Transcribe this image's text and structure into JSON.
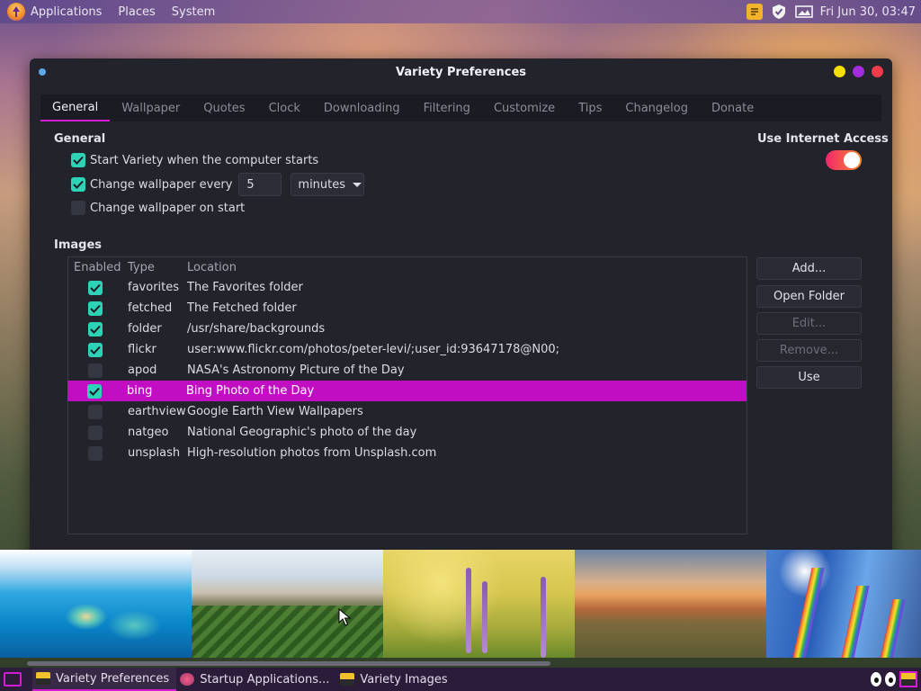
{
  "top_panel": {
    "menus": [
      "Applications",
      "Places",
      "System"
    ],
    "clock": "Fri Jun 30, 03:47"
  },
  "window": {
    "title": "Variety Preferences",
    "tabs": [
      {
        "label": "General",
        "active": true
      },
      {
        "label": "Wallpaper"
      },
      {
        "label": "Quotes"
      },
      {
        "label": "Clock"
      },
      {
        "label": "Downloading"
      },
      {
        "label": "Filtering"
      },
      {
        "label": "Customize"
      },
      {
        "label": "Tips"
      },
      {
        "label": "Changelog"
      },
      {
        "label": "Donate"
      }
    ]
  },
  "general": {
    "heading": "General",
    "start_on_boot": {
      "label": "Start Variety when the computer starts",
      "checked": true
    },
    "change_every": {
      "label": "Change wallpaper every",
      "checked": true,
      "value": "5",
      "unit": "minutes"
    },
    "change_on_start": {
      "label": "Change wallpaper on start",
      "checked": false
    }
  },
  "internet": {
    "label": "Use Internet Access",
    "enabled": true
  },
  "images": {
    "heading": "Images",
    "columns": [
      "Enabled",
      "Type",
      "Location"
    ],
    "rows": [
      {
        "enabled": true,
        "type": "favorites",
        "location": "The Favorites folder"
      },
      {
        "enabled": true,
        "type": "fetched",
        "location": "The Fetched folder"
      },
      {
        "enabled": true,
        "type": "folder",
        "location": "/usr/share/backgrounds"
      },
      {
        "enabled": true,
        "type": "flickr",
        "location": "user:www.flickr.com/photos/peter-levi/;user_id:93647178@N00;"
      },
      {
        "enabled": false,
        "type": "apod",
        "location": "NASA's Astronomy Picture of the Day"
      },
      {
        "enabled": true,
        "type": "bing",
        "location": "Bing Photo of the Day",
        "selected": true
      },
      {
        "enabled": false,
        "type": "earthview",
        "location": "Google Earth View Wallpapers"
      },
      {
        "enabled": false,
        "type": "natgeo",
        "location": "National Geographic's photo of the day"
      },
      {
        "enabled": false,
        "type": "unsplash",
        "location": "High-resolution photos from Unsplash.com"
      }
    ],
    "buttons": {
      "add": "Add...",
      "open_folder": "Open Folder",
      "edit": "Edit...",
      "remove": "Remove...",
      "use": "Use"
    }
  },
  "taskbar": {
    "tasks": [
      {
        "label": "Variety Preferences",
        "active": true
      },
      {
        "label": "Startup Applications..."
      },
      {
        "label": "Variety Images"
      }
    ]
  },
  "colors": {
    "accent": "#c20ec2",
    "check": "#2ed3b7",
    "toggle_on": "#f2266e"
  }
}
